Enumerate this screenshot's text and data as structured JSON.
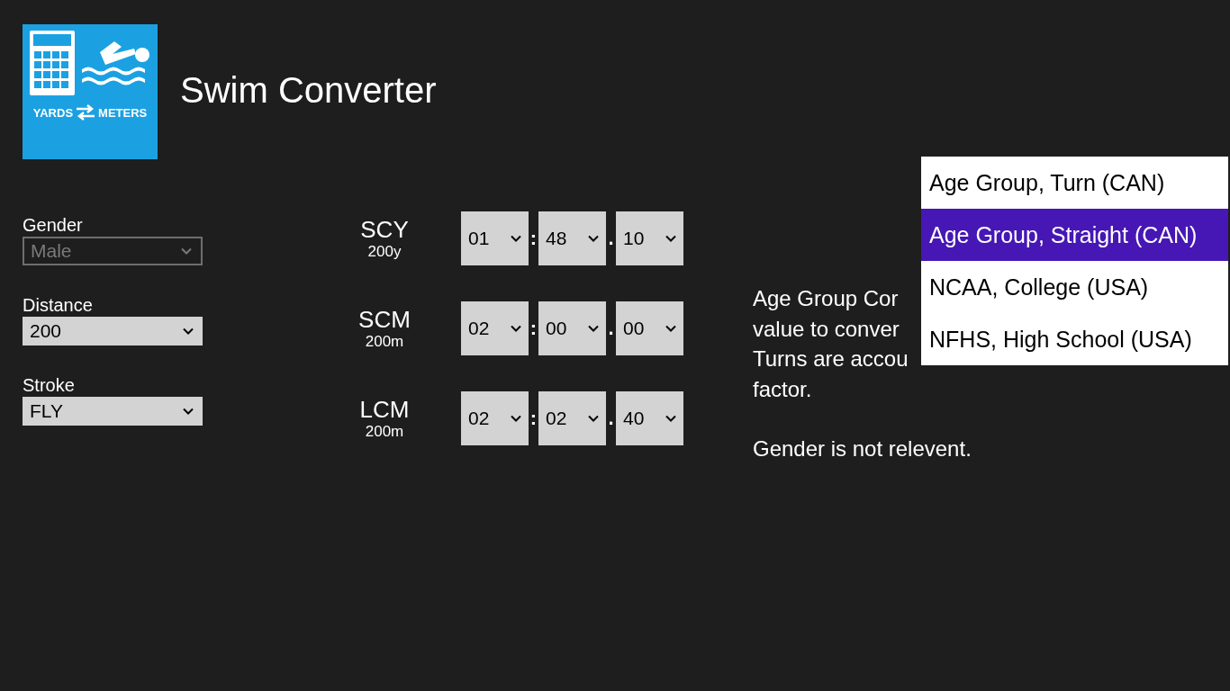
{
  "app": {
    "title": "Swim Converter",
    "logo": {
      "left_text": "YARDS",
      "right_text": "METERS"
    }
  },
  "fields": [
    {
      "label": "Gender",
      "value": "Male",
      "disabled": true
    },
    {
      "label": "Distance",
      "value": "200",
      "disabled": false
    },
    {
      "label": "Stroke",
      "value": "FLY",
      "disabled": false
    }
  ],
  "courses": [
    {
      "course": "SCY",
      "distance": "200y",
      "segments": [
        "01",
        "48",
        "10"
      ],
      "separators": [
        ":",
        "."
      ]
    },
    {
      "course": "SCM",
      "distance": "200m",
      "segments": [
        "02",
        "00",
        "00"
      ],
      "separators": [
        ":",
        "."
      ]
    },
    {
      "course": "LCM",
      "distance": "200m",
      "segments": [
        "02",
        "02",
        "40"
      ],
      "separators": [
        ":",
        "."
      ]
    }
  ],
  "description": {
    "lines": [
      "Age Group Cor",
      "value to conver",
      "Turns are accou",
      "factor."
    ],
    "note": "Gender is not relevent."
  },
  "dropdown": {
    "items": [
      {
        "label": "Age Group, Turn (CAN)",
        "selected": false
      },
      {
        "label": "Age Group, Straight (CAN)",
        "selected": true
      },
      {
        "label": "NCAA, College (USA)",
        "selected": false
      },
      {
        "label": "NFHS, High School (USA)",
        "selected": false
      }
    ]
  }
}
